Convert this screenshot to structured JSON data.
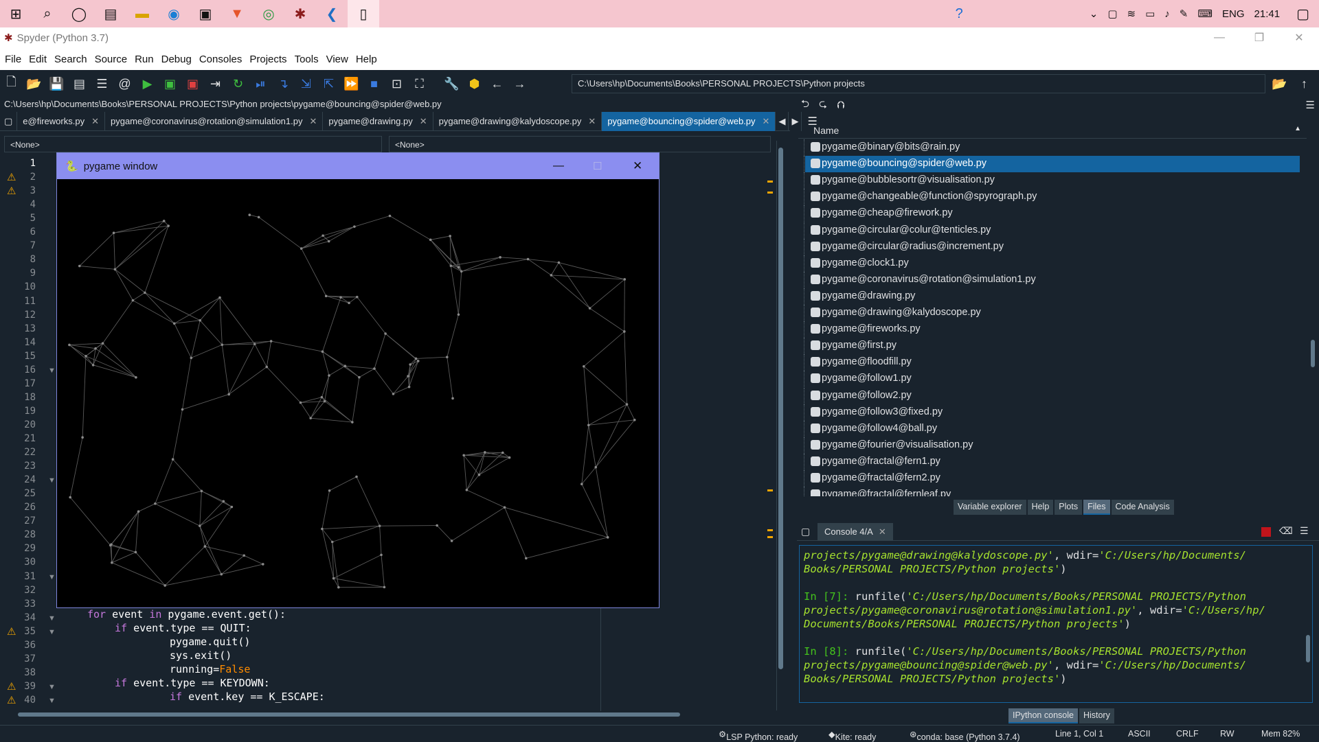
{
  "taskbar": {
    "clock": "21:41",
    "lang": "ENG"
  },
  "window": {
    "title": "Spyder (Python 3.7)"
  },
  "menu": [
    "File",
    "Edit",
    "Search",
    "Source",
    "Run",
    "Debug",
    "Consoles",
    "Projects",
    "Tools",
    "View",
    "Help"
  ],
  "toolbar": {
    "working_dir": "C:\\Users\\hp\\Documents\\Books\\PERSONAL PROJECTS\\Python projects"
  },
  "editor": {
    "file_path": "C:\\Users\\hp\\Documents\\Books\\PERSONAL PROJECTS\\Python projects\\pygame@bouncing@spider@web.py",
    "tabs": [
      "e@fireworks.py",
      "pygame@coronavirus@rotation@simulation1.py",
      "pygame@drawing.py",
      "pygame@drawing@kalydoscope.py",
      "pygame@bouncing@spider@web.py"
    ],
    "combo_left": "<None>",
    "combo_right": "<None>",
    "line_numbers": [
      "1",
      "2",
      "3",
      "4",
      "5",
      "6",
      "7",
      "8",
      "9",
      "10",
      "11",
      "12",
      "13",
      "14",
      "15",
      "16",
      "17",
      "18",
      "19",
      "20",
      "21",
      "22",
      "23",
      "24",
      "25",
      "26",
      "27",
      "28",
      "29",
      "30",
      "31",
      "32",
      "33",
      "34",
      "35",
      "36",
      "37",
      "38",
      "39",
      "40"
    ],
    "code": {
      "l34_kw": "for",
      "l34_a": " event ",
      "l34_kw2": "in",
      "l34_b": " pygame.event.get():",
      "l35_kw": "if",
      "l35_a": " event.type == QUIT:",
      "l36": "pygame.quit()",
      "l37": "sys.exit()",
      "l38_a": "running=",
      "l38_b": "False",
      "l39_kw": "if",
      "l39_a": " event.type == KEYDOWN:",
      "l40_kw": "if",
      "l40_a": " event.key == K_ESCAPE:"
    }
  },
  "pygame_window": {
    "title": "pygame window"
  },
  "files": {
    "header": "Name",
    "items": [
      "pygame@binary@bits@rain.py",
      "pygame@bouncing@spider@web.py",
      "pygame@bubblesortr@visualisation.py",
      "pygame@changeable@function@spyrograph.py",
      "pygame@cheap@firework.py",
      "pygame@circular@colur@tenticles.py",
      "pygame@circular@radius@increment.py",
      "pygame@clock1.py",
      "pygame@coronavirus@rotation@simulation1.py",
      "pygame@drawing.py",
      "pygame@drawing@kalydoscope.py",
      "pygame@fireworks.py",
      "pygame@first.py",
      "pygame@floodfill.py",
      "pygame@follow1.py",
      "pygame@follow2.py",
      "pygame@follow3@fixed.py",
      "pygame@follow4@ball.py",
      "pygame@fourier@visualisation.py",
      "pygame@fractal@fern1.py",
      "pygame@fractal@fern2.py",
      "pygame@fractal@fernleaf.py"
    ],
    "selected_index": 1
  },
  "panel_tabs": [
    "Variable explorer",
    "Help",
    "Plots",
    "Files",
    "Code Analysis"
  ],
  "console": {
    "tab": "Console 4/A",
    "l1a": "projects/pygame@drawing@kalydoscope.py'",
    "l1b": ", wdir=",
    "l1c": "'C:/Users/hp/Documents/",
    "l2": "Books/PERSONAL PROJECTS/Python projects'",
    "l2b": ")",
    "p7": "In [7]:",
    "r7a": " runfile(",
    "r7b": "'C:/Users/hp/Documents/Books/PERSONAL PROJECTS/Python",
    "r7c": "projects/pygame@coronavirus@rotation@simulation1.py'",
    "r7d": ", wdir=",
    "r7e": "'C:/Users/hp/",
    "r7f": "Documents/Books/PERSONAL PROJECTS/Python projects'",
    "r7g": ")",
    "p8": "In [8]:",
    "r8a": " runfile(",
    "r8b": "'C:/Users/hp/Documents/Books/PERSONAL PROJECTS/Python",
    "r8c": "projects/pygame@bouncing@spider@web.py'",
    "r8d": ", wdir=",
    "r8e": "'C:/Users/hp/Documents/",
    "r8f": "Books/PERSONAL PROJECTS/Python projects'",
    "r8g": ")"
  },
  "console_tabs": [
    "IPython console",
    "History"
  ],
  "status": {
    "lsp": "LSP Python: ready",
    "kite": "Kite: ready",
    "conda": "conda: base (Python 3.7.4)",
    "pos": "Line 1, Col 1",
    "enc": "ASCII",
    "eol": "CRLF",
    "rw": "RW",
    "mem": "Mem 82%"
  },
  "colors": {
    "background": "#19232d",
    "selection": "#1464a0",
    "taskbar": "#f5c6cf",
    "pygame_title": "#8b8ef0"
  }
}
